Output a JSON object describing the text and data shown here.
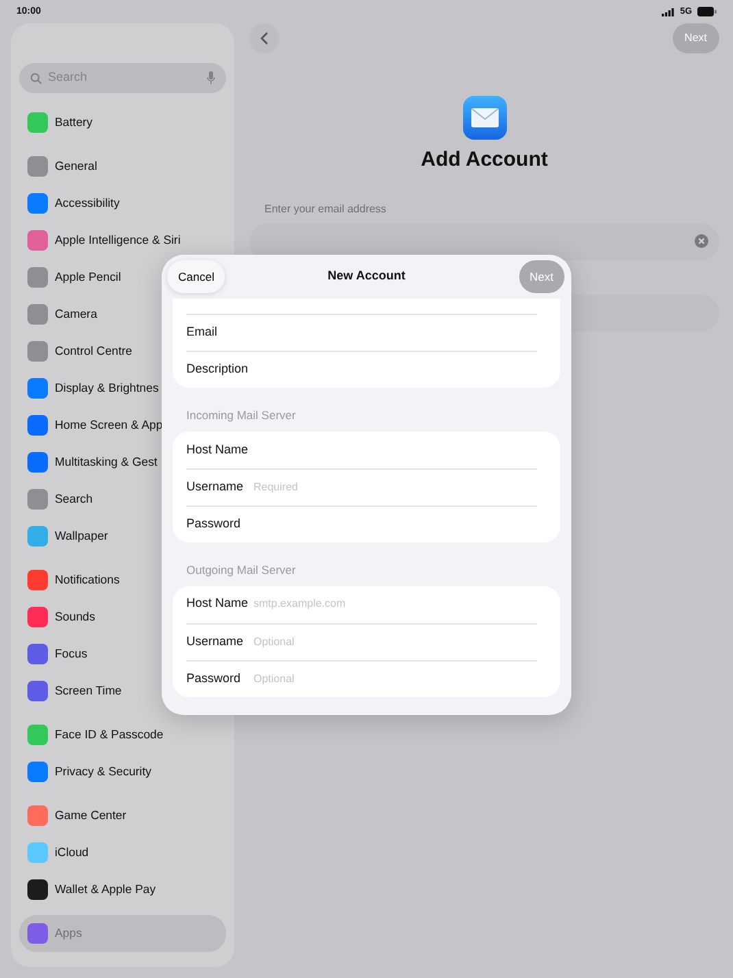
{
  "status_bar": {
    "time": "10:00",
    "network": "5G"
  },
  "sidebar": {
    "search_placeholder": "Search",
    "groups": [
      [
        {
          "label": "Battery",
          "color": "#34c759",
          "selected": false
        }
      ],
      [
        {
          "label": "General",
          "color": "#8e8e93",
          "selected": false
        },
        {
          "label": "Accessibility",
          "color": "#0a7aff",
          "selected": false
        },
        {
          "label": "Apple Intelligence & Siri",
          "color": "#e0609a",
          "selected": false
        },
        {
          "label": "Apple Pencil",
          "color": "#8e8e93",
          "selected": false
        },
        {
          "label": "Camera",
          "color": "#8e8e93",
          "selected": false
        },
        {
          "label": "Control Centre",
          "color": "#8e8e93",
          "selected": false
        },
        {
          "label": "Display & Brightnes",
          "color": "#0a7aff",
          "selected": false
        },
        {
          "label": "Home Screen & App",
          "color": "#0a6cff",
          "selected": false
        },
        {
          "label": "Multitasking & Gest",
          "color": "#0a6cff",
          "selected": false
        },
        {
          "label": "Search",
          "color": "#8e8e93",
          "selected": false
        },
        {
          "label": "Wallpaper",
          "color": "#32ade6",
          "selected": false
        }
      ],
      [
        {
          "label": "Notifications",
          "color": "#ff3b30",
          "selected": false
        },
        {
          "label": "Sounds",
          "color": "#ff2d55",
          "selected": false
        },
        {
          "label": "Focus",
          "color": "#5e5ce6",
          "selected": false
        },
        {
          "label": "Screen Time",
          "color": "#5e5ce6",
          "selected": false
        }
      ],
      [
        {
          "label": "Face ID & Passcode",
          "color": "#34c759",
          "selected": false
        },
        {
          "label": "Privacy & Security",
          "color": "#0a7aff",
          "selected": false
        }
      ],
      [
        {
          "label": "Game Center",
          "color": "#ff6b5a",
          "selected": false
        },
        {
          "label": "iCloud",
          "color": "#5ac8fa",
          "selected": false
        },
        {
          "label": "Wallet & Apple Pay",
          "color": "#1c1c1e",
          "selected": false
        }
      ],
      [
        {
          "label": "Apps",
          "color": "#7d5ce6",
          "selected": true
        }
      ]
    ]
  },
  "main": {
    "next_button": {
      "label": "Next",
      "disabled": true
    },
    "title": "Add Account",
    "email_label": "Enter your email address"
  },
  "modal": {
    "cancel": "Cancel",
    "title": "New Account",
    "next_button": {
      "label": "Next",
      "disabled": true
    },
    "sections": [
      {
        "rows": [
          {
            "label": "Email"
          },
          {
            "label": "Description"
          }
        ]
      },
      {
        "header": "Incoming Mail Server",
        "rows": [
          {
            "label": "Host Name"
          },
          {
            "label": "Username",
            "placeholder": "Required"
          },
          {
            "label": "Password"
          }
        ]
      },
      {
        "header": "Outgoing Mail Server",
        "rows": [
          {
            "label": "Host Name",
            "placeholder": "smtp.example.com"
          },
          {
            "label": "Username",
            "placeholder": "Optional"
          },
          {
            "label": "Password",
            "placeholder": "Optional"
          }
        ]
      }
    ]
  }
}
